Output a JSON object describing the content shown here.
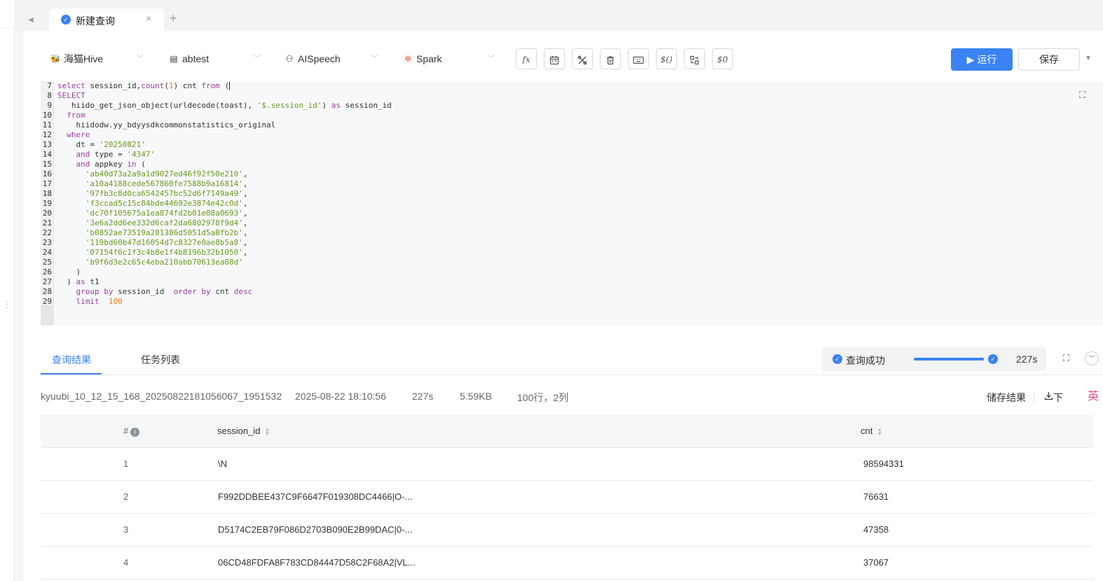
{
  "tabs": {
    "active_tab_label": "新建查询",
    "close_glyph": "×",
    "add_glyph": "+",
    "back_glyph": "◀"
  },
  "toolbar": {
    "datasource": "海猫Hive",
    "database": "abtest",
    "account": "AISpeech",
    "engine": "Spark",
    "run_label": "运行",
    "save_label": "保存",
    "icon_buttons": [
      "fx-icon",
      "calendar-icon",
      "tools-icon",
      "trash-icon",
      "keyboard-icon",
      "variable-icon",
      "format-icon",
      "param-icon"
    ]
  },
  "editor": {
    "line_numbers": [
      "7",
      "8",
      "9",
      "10",
      "11",
      "12",
      "13",
      "14",
      "15",
      "16",
      "17",
      "18",
      "19",
      "20",
      "21",
      "22",
      "23",
      "24",
      "25",
      "26",
      "27",
      "28",
      "29"
    ]
  },
  "result_tabs": {
    "results_label": "查询结果",
    "tasks_label": "任务列表"
  },
  "status": {
    "text": "查询成功",
    "progress": 1.0,
    "duration": "227s"
  },
  "meta": {
    "job_id": "kyuubi_10_12_15_168_20250822181056067_1951532",
    "timestamp": "2025-08-22 18:10:56",
    "duration": "227s",
    "size": "5.59KB",
    "shape": "100行，2列",
    "store_label": "储存结果",
    "download_label": "下",
    "lang_label": "英"
  },
  "table": {
    "columns": [
      "#",
      "session_id",
      "cnt"
    ],
    "rows": [
      {
        "idx": "1",
        "session_id": "\\N",
        "cnt": "98594331"
      },
      {
        "idx": "2",
        "session_id": "F992DDBEE437C9F6647F019308DC4466|O-...",
        "cnt": "76631"
      },
      {
        "idx": "3",
        "session_id": "D5174C2EB79F086D2703B090E2B99DAC|0-...",
        "cnt": "47358"
      },
      {
        "idx": "4",
        "session_id": "06CD48FDFA8F783CD84447D58C2F68A2|VL...",
        "cnt": "37067"
      }
    ]
  },
  "colors": {
    "accent": "#3b82f6",
    "keyword": "#9b3f9f",
    "string": "#6a9a1f",
    "number": "#e07a1f"
  }
}
